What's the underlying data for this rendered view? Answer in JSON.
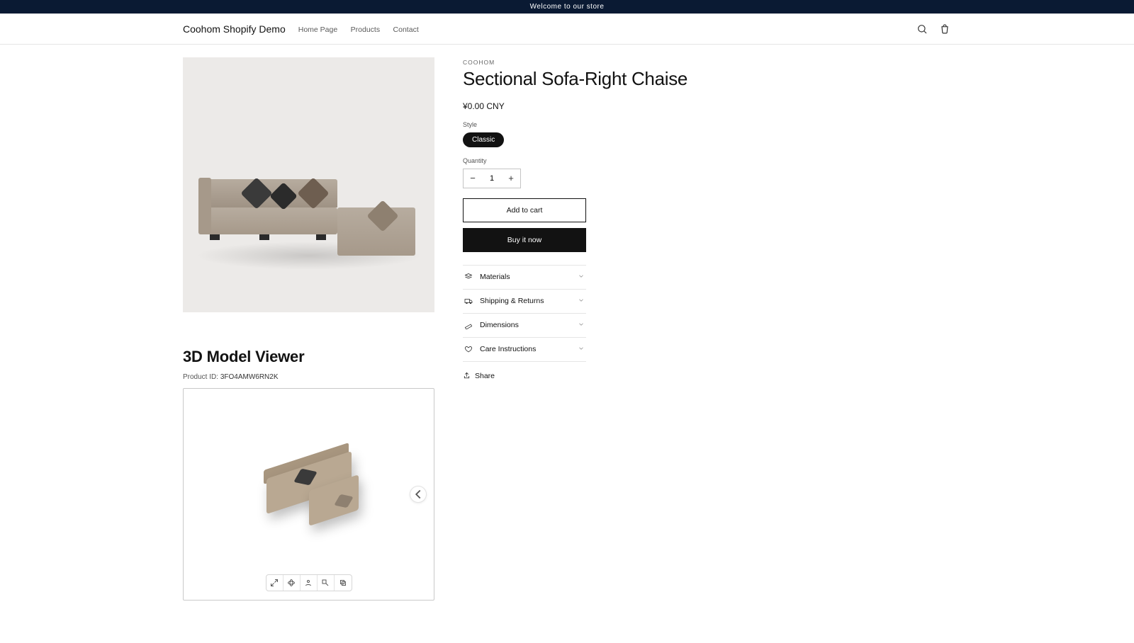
{
  "announcement": "Welcome to our store",
  "header": {
    "brand": "Coohom Shopify Demo",
    "nav": {
      "home": "Home Page",
      "products": "Products",
      "contact": "Contact"
    }
  },
  "product": {
    "vendor": "COOHOM",
    "title": "Sectional Sofa-Right Chaise",
    "price": "¥0.00 CNY",
    "style_label": "Style",
    "style_option": "Classic",
    "qty_label": "Quantity",
    "qty_value": "1",
    "add_to_cart": "Add to cart",
    "buy_now": "Buy it now",
    "accordion": {
      "materials": "Materials",
      "shipping": "Shipping & Returns",
      "dimensions": "Dimensions",
      "care": "Care Instructions"
    },
    "share": "Share"
  },
  "viewer": {
    "heading": "3D Model Viewer",
    "pid_label": "Product ID:",
    "pid_value": "3FO4AMW6RN2K"
  }
}
